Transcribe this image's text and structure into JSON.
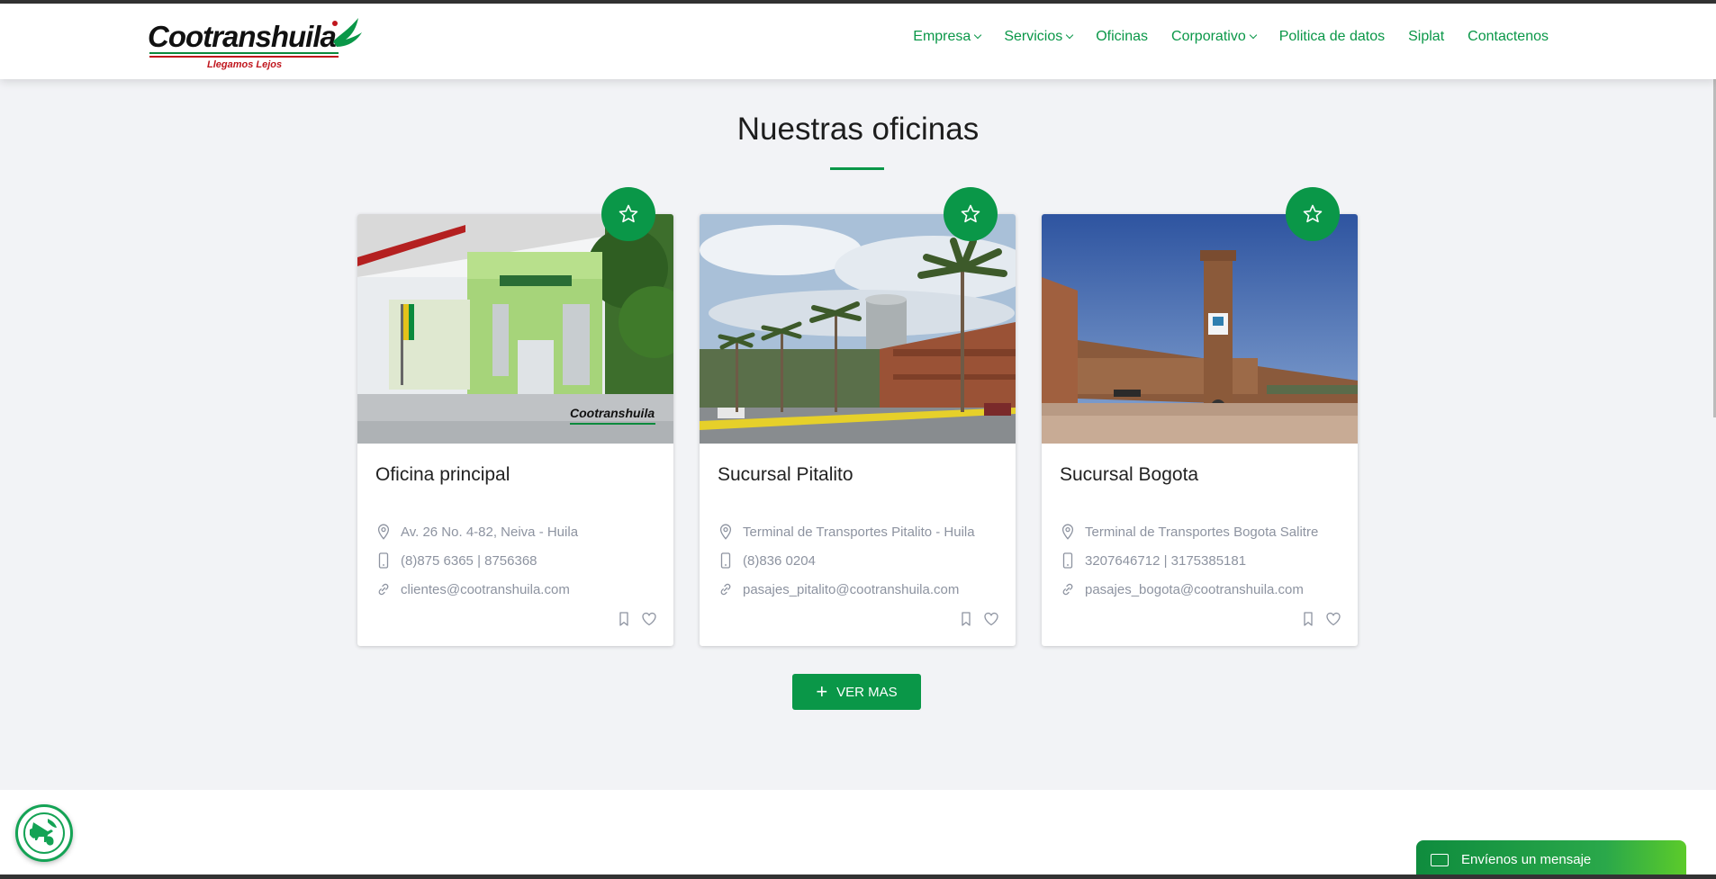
{
  "brand": {
    "name": "Cootranshuila",
    "tagline": "Llegamos Lejos"
  },
  "nav": [
    {
      "label": "Empresa",
      "dropdown": true
    },
    {
      "label": "Servicios",
      "dropdown": true
    },
    {
      "label": "Oficinas",
      "dropdown": false
    },
    {
      "label": "Corporativo",
      "dropdown": true
    },
    {
      "label": "Politica de datos",
      "dropdown": false
    },
    {
      "label": "Siplat",
      "dropdown": false
    },
    {
      "label": "Contactenos",
      "dropdown": false
    }
  ],
  "section": {
    "title": "Nuestras oficinas"
  },
  "offices": [
    {
      "title": "Oficina principal",
      "address": "Av. 26 No. 4-82, Neiva - Huila",
      "phone": "(8)875 6365 | 8756368",
      "email": "clientes@cootranshuila.com",
      "image_sign": "Cootranshuila"
    },
    {
      "title": "Sucursal Pitalito",
      "address": "Terminal de Transportes Pitalito - Huila",
      "phone": "(8)836 0204",
      "email": "pasajes_pitalito@cootranshuila.com"
    },
    {
      "title": "Sucursal Bogota",
      "address": "Terminal de Transportes Bogota Salitre",
      "phone": "3207646712 | 3175385181",
      "email": "pasajes_bogota@cootranshuila.com"
    }
  ],
  "more_button": {
    "label": "VER MAS"
  },
  "chat": {
    "label": "Envíenos un mensaje"
  },
  "colors": {
    "brand_green": "#0a9748",
    "brand_red": "#c0161d",
    "background": "#f2f3f6"
  }
}
